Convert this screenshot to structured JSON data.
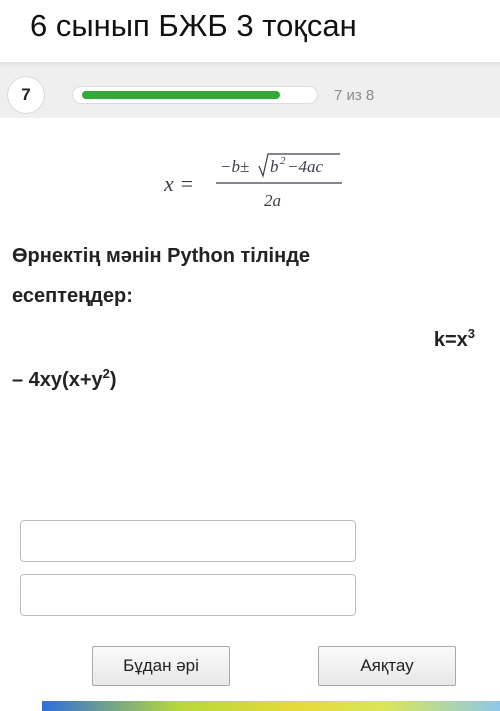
{
  "header": {
    "title": "6 сынып БЖБ 3 тоқсан"
  },
  "question_bar": {
    "number": "7",
    "progress_text": "7 из 8",
    "progress_fraction": 0.875,
    "progress_color": "#33a93a"
  },
  "formula": {
    "lhs": "x =",
    "numerator_pre": "−b±",
    "sqrt_b": "b",
    "sqrt_exp": "2",
    "sqrt_rest": " −4ac",
    "denominator": "2a"
  },
  "question": {
    "line1": "Өрнектің мәнін Python тілінде",
    "line2": "есептеңдер:"
  },
  "expression": {
    "part1_base": "k=x",
    "part1_exp": "3",
    "part2_pre": "– 4xy(x+y",
    "part2_exp": "2",
    "part2_post": ")"
  },
  "answers": [
    {
      "value": "",
      "placeholder": ""
    },
    {
      "value": "",
      "placeholder": ""
    }
  ],
  "buttons": {
    "next": "Бұдан әрі",
    "finish": "Аяқтау"
  }
}
